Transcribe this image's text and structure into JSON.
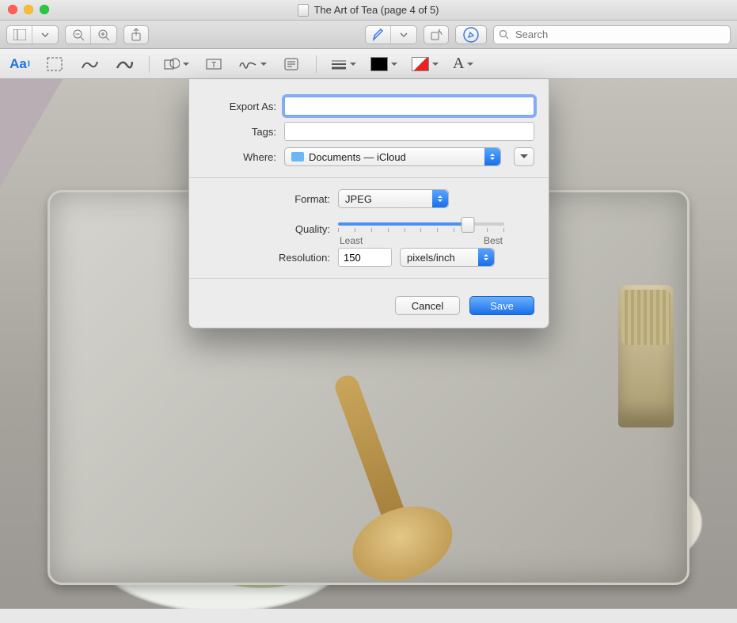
{
  "window": {
    "title": "The Art of Tea (page 4 of 5)"
  },
  "toolbar": {
    "search_placeholder": "Search"
  },
  "export": {
    "export_as_label": "Export As:",
    "export_as_value": "",
    "tags_label": "Tags:",
    "tags_value": "",
    "where_label": "Where:",
    "where_value": "Documents — iCloud",
    "format_label": "Format:",
    "format_value": "JPEG",
    "quality_label": "Quality:",
    "quality_least": "Least",
    "quality_best": "Best",
    "resolution_label": "Resolution:",
    "resolution_value": "150",
    "resolution_unit": "pixels/inch",
    "cancel": "Cancel",
    "save": "Save"
  }
}
